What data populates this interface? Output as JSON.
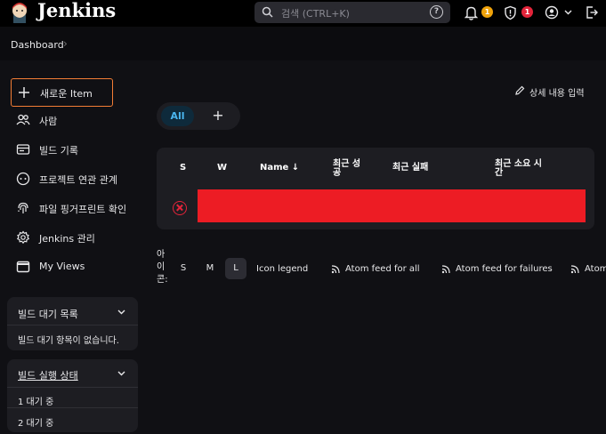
{
  "header": {
    "brand": "Jenkins",
    "search_placeholder": "검색 (CTRL+K)",
    "help_label": "?",
    "notifications_count": "1",
    "security_count": "1"
  },
  "breadcrumb": {
    "dashboard": "Dashboard"
  },
  "sidebar": {
    "items": [
      {
        "label": "새로운 Item",
        "icon": "plus-icon"
      },
      {
        "label": "사람",
        "icon": "people-icon"
      },
      {
        "label": "빌드 기록",
        "icon": "history-icon"
      },
      {
        "label": "프로젝트 연관 관계",
        "icon": "relationship-icon"
      },
      {
        "label": "파일 핑거프린트 확인",
        "icon": "fingerprint-icon"
      },
      {
        "label": "Jenkins 관리",
        "icon": "gear-icon"
      },
      {
        "label": "My Views",
        "icon": "window-icon"
      }
    ],
    "build_queue": {
      "title": "빌드 대기 목록",
      "empty_text": "빌드 대기 항목이 없습니다."
    },
    "executors": {
      "title": "빌드 실행 상태",
      "rows": [
        "1 대기 중",
        "2 대기 중"
      ]
    }
  },
  "main": {
    "edit_description": "상세 내용 입력",
    "tabs": {
      "all": "All",
      "add": "+"
    },
    "table": {
      "headers": {
        "s": "S",
        "w": "W",
        "name": "Name ↓",
        "last_success": "최근 성공",
        "last_failure": "최근 실패",
        "last_duration": "최근 소요 시간"
      },
      "rows": [
        {
          "status": "failed"
        }
      ]
    },
    "icon_legend": {
      "label": "아이콘:",
      "sizes": [
        "S",
        "M",
        "L"
      ],
      "selected_size": "L",
      "legend_link": "Icon legend",
      "feeds": [
        "Atom feed for all",
        "Atom feed for failures",
        "Atom"
      ]
    }
  },
  "colors": {
    "accent": "#4ab6ef",
    "new_item_border": "#f37d35",
    "error": "#e3243a",
    "redacted": "#ed1c24"
  }
}
